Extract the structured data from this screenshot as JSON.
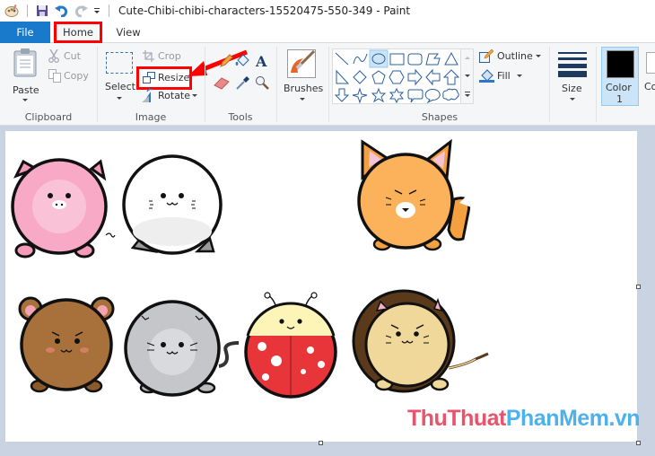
{
  "titlebar": {
    "app_icon": "paint-palette-icon",
    "quick_access": [
      "save-icon",
      "undo-icon",
      "redo-icon",
      "customize-dropdown-icon"
    ],
    "title": "Cute-Chibi-chibi-characters-15520475-550-349 - Paint"
  },
  "tabs": [
    {
      "label": "File",
      "active": false
    },
    {
      "label": "Home",
      "active": true,
      "highlighted": true
    },
    {
      "label": "View",
      "active": false
    }
  ],
  "ribbon": {
    "clipboard": {
      "group_label": "Clipboard",
      "paste": "Paste",
      "cut": "Cut",
      "copy": "Copy"
    },
    "image": {
      "group_label": "Image",
      "select": "Select",
      "crop": "Crop",
      "resize": "Resize",
      "rotate": "Rotate"
    },
    "tools": {
      "group_label": "Tools",
      "items": [
        "pencil-icon",
        "fill-bucket-icon",
        "text-icon",
        "eraser-icon",
        "color-picker-icon",
        "magnifier-icon"
      ]
    },
    "brushes": {
      "label": "Brushes"
    },
    "shapes": {
      "group_label": "Shapes",
      "items": [
        "line",
        "curve",
        "oval",
        "rectangle",
        "rounded-rectangle",
        "polygon",
        "triangle",
        "right-triangle",
        "diamond",
        "pentagon",
        "hexagon",
        "right-arrow",
        "left-arrow",
        "up-arrow",
        "down-arrow",
        "four-point-star",
        "five-point-star",
        "six-point-star",
        "rounded-callout",
        "oval-callout",
        "cloud-callout"
      ],
      "selected": "oval",
      "outline": "Outline",
      "fill": "Fill"
    },
    "size": {
      "label": "Size"
    },
    "color1": {
      "label": "Color",
      "number": "1",
      "value": "#000000"
    },
    "color2": {
      "label": "Co"
    }
  },
  "canvas": {
    "characters": [
      "pig",
      "white-seal-cat",
      "fox",
      "bear",
      "gray-cat",
      "ladybug",
      "lion"
    ],
    "watermark_part1": "ThuThuat",
    "watermark_part2": "PhanMem.vn"
  },
  "colors": {
    "file_tab": "#1979ca",
    "highlight": "#ff0000",
    "canvas_bg": "#c9d3e2",
    "watermark_red": "#e8546b",
    "watermark_blue": "#4eb1ea"
  }
}
